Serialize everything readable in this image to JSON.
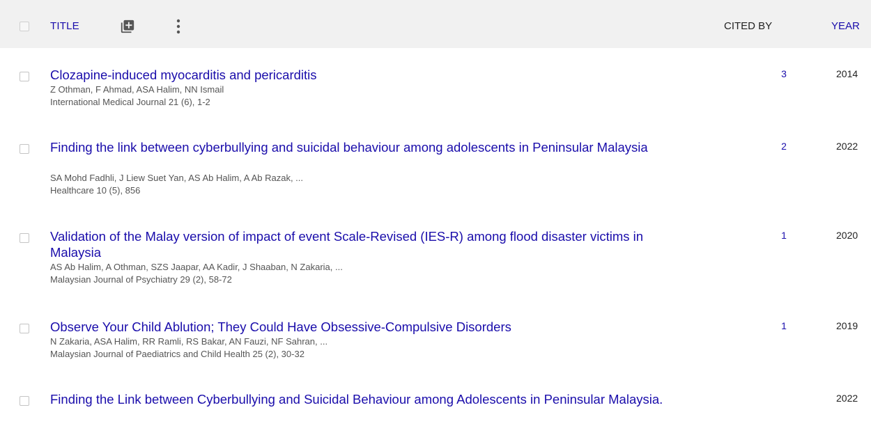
{
  "header": {
    "title_label": "TITLE",
    "cited_by_label": "CITED BY",
    "year_label": "YEAR",
    "add_icon": "add-box-icon",
    "more_icon": "more-vert-icon"
  },
  "articles": [
    {
      "title": "Clozapine-induced myocarditis and pericarditis",
      "authors": "Z Othman, F Ahmad, ASA Halim, NN Ismail",
      "venue": "International Medical Journal 21 (6), 1-2",
      "cited_by": "3",
      "year": "2014"
    },
    {
      "title": "Finding the link between cyberbullying and suicidal behaviour among adolescents in Peninsular Malaysia",
      "authors": "SA Mohd Fadhli, J Liew Suet Yan, AS Ab Halim, A Ab Razak, ...",
      "venue": "Healthcare 10 (5), 856",
      "cited_by": "2",
      "year": "2022"
    },
    {
      "title": "Validation of the Malay version of impact of event Scale-Revised (IES-R) among flood disaster victims in Malaysia",
      "authors": "AS Ab Halim, A Othman, SZS Jaapar, AA Kadir, J Shaaban, N Zakaria, ...",
      "venue": "Malaysian Journal of Psychiatry 29 (2), 58-72",
      "cited_by": "1",
      "year": "2020"
    },
    {
      "title": "Observe Your Child Ablution; They Could Have Obsessive-Compulsive Disorders",
      "authors": "N Zakaria, ASA Halim, RR Ramli, RS Bakar, AN Fauzi, NF Sahran, ...",
      "venue": "Malaysian Journal of Paediatrics and Child Health 25 (2), 30-32",
      "cited_by": "1",
      "year": "2019"
    },
    {
      "title": "Finding the Link between Cyberbullying and Suicidal Behaviour among Adolescents in Peninsular Malaysia.",
      "authors": "",
      "venue": "",
      "cited_by": "",
      "year": "2022"
    }
  ]
}
